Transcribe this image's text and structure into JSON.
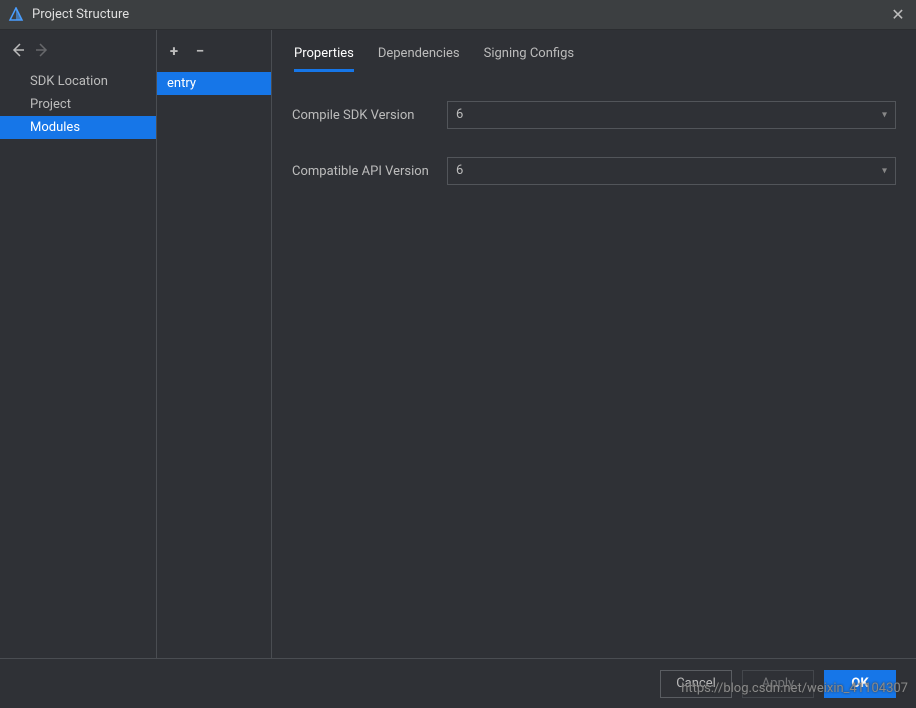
{
  "window": {
    "title": "Project Structure"
  },
  "sidebar": {
    "items": [
      {
        "label": "SDK Location",
        "selected": false
      },
      {
        "label": "Project",
        "selected": false
      },
      {
        "label": "Modules",
        "selected": true
      }
    ]
  },
  "module_list": {
    "items": [
      {
        "label": "entry",
        "selected": true
      }
    ]
  },
  "tabs": {
    "items": [
      {
        "label": "Properties",
        "active": true
      },
      {
        "label": "Dependencies",
        "active": false
      },
      {
        "label": "Signing Configs",
        "active": false
      }
    ]
  },
  "properties": {
    "compile_sdk_label": "Compile SDK Version",
    "compile_sdk_value": "6",
    "compatible_api_label": "Compatible API Version",
    "compatible_api_value": "6"
  },
  "footer": {
    "cancel": "Cancel",
    "apply": "Apply",
    "ok": "OK"
  },
  "watermark": "https://blog.csdn.net/weixin_41104307"
}
